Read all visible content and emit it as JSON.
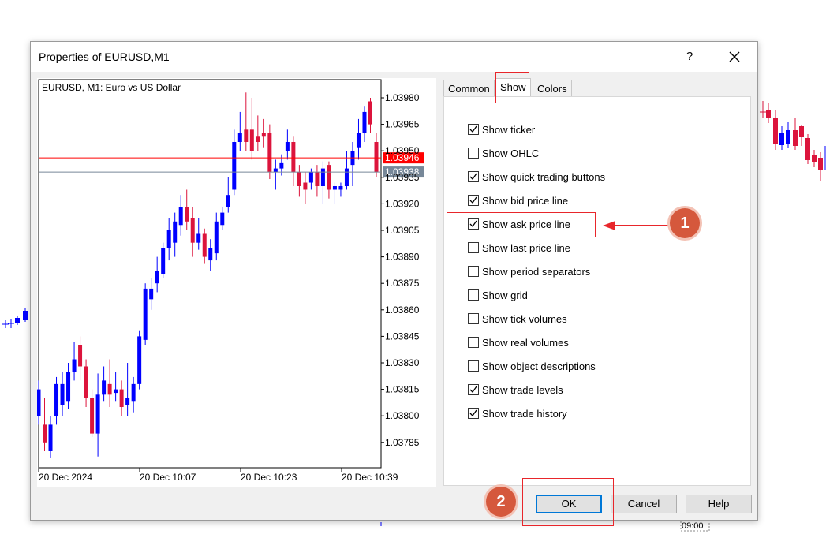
{
  "dialog": {
    "title": "Properties of EURUSD,M1",
    "help_label": "?",
    "close_icon": "close-icon"
  },
  "preview": {
    "symbol_label": "EURUSD, M1:  Euro vs US Dollar",
    "price_labels": [
      "1.03980",
      "1.03965",
      "1.03950",
      "1.03935",
      "1.03920",
      "1.03905",
      "1.03890",
      "1.03875",
      "1.03860",
      "1.03845",
      "1.03830",
      "1.03815",
      "1.03800",
      "1.03785"
    ],
    "time_labels": [
      "20 Dec 2024",
      "20 Dec 10:07",
      "20 Dec 10:23",
      "20 Dec 10:39"
    ],
    "bid_price": "1.03946",
    "ask_price": "1.03938",
    "colors": {
      "bull": "#0000ff",
      "bear": "#dc143c",
      "bid_line": "#ff0000",
      "ask_line": "#778899",
      "bid_tag": "#ff0000",
      "ask_tag": "#778899"
    }
  },
  "tabs": [
    {
      "label": "Common"
    },
    {
      "label": "Show"
    },
    {
      "label": "Colors"
    }
  ],
  "options": [
    {
      "label": "Show ticker",
      "checked": true
    },
    {
      "label": "Show OHLC",
      "checked": false
    },
    {
      "label": "Show quick trading buttons",
      "checked": true
    },
    {
      "label": "Show bid price line",
      "checked": true
    },
    {
      "label": "Show ask price line",
      "checked": true
    },
    {
      "label": "Show last price line",
      "checked": false
    },
    {
      "label": "Show period separators",
      "checked": false
    },
    {
      "label": "Show grid",
      "checked": false
    },
    {
      "label": "Show tick volumes",
      "checked": false
    },
    {
      "label": "Show real volumes",
      "checked": false
    },
    {
      "label": "Show object descriptions",
      "checked": false
    },
    {
      "label": "Show trade levels",
      "checked": true
    },
    {
      "label": "Show trade history",
      "checked": true
    }
  ],
  "buttons": {
    "ok": "OK",
    "cancel": "Cancel",
    "help": "Help"
  },
  "annotations": {
    "badge1": "1",
    "badge2": "2",
    "highlight_color": "#e8262b",
    "badge_color": "#d5583c"
  },
  "background": {
    "time_label": "09:00"
  }
}
